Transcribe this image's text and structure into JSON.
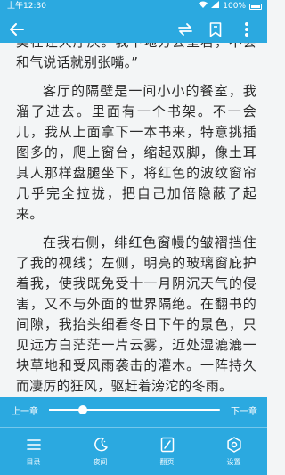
{
  "status_bar": {
    "time": "上午12:30",
    "battery": "100%"
  },
  "toolbar": {
    "back_icon": "back-arrow-icon",
    "refresh_icon": "swap-icon",
    "bookmark_icon": "bookmark-icon",
    "more_icon": "more-vertical-icon"
  },
  "content": {
    "paragraphs": [
      "美在让大厅厌。我下地方去呈看，不会和气说话就别张嘴。”",
      "客厅的隔壁是一间小小的餐室，我溜了进去。里面有一个书架。不一会儿，我从上面拿下一本书来，特意挑插图多的，爬上窗台，缩起双脚，像土耳其人那样盘腿坐下，将红色的波纹窗帘几乎完全拉拢，把自己加倍隐蔽了起来。",
      "在我右侧，绯红色窗幔的皱褶挡住了我的视线；左侧，明亮的玻璃窗庇护着我，使我既免受十一月阴沉天气的侵害，又不与外面的世界隔绝。在翻书的间隙，我抬头细看冬日下午的景色，只见远方白茫茫一片云雾，近处湿漉漉一块草地和受风雨袭击的灌木。一阵持久而凄厉的狂风，驱赶着滂沱的冬雨。"
    ]
  },
  "progress": {
    "prev_label": "上一章",
    "next_label": "下一章",
    "fraction": 0.2
  },
  "nav": [
    {
      "label": "目录",
      "icon": "menu-icon"
    },
    {
      "label": "夜间",
      "icon": "moon-icon"
    },
    {
      "label": "翻页",
      "icon": "page-turn-icon"
    },
    {
      "label": "设置",
      "icon": "gear-icon"
    }
  ],
  "colors": {
    "accent": "#2ba9e0",
    "page_bg": "#f3f5f6"
  }
}
